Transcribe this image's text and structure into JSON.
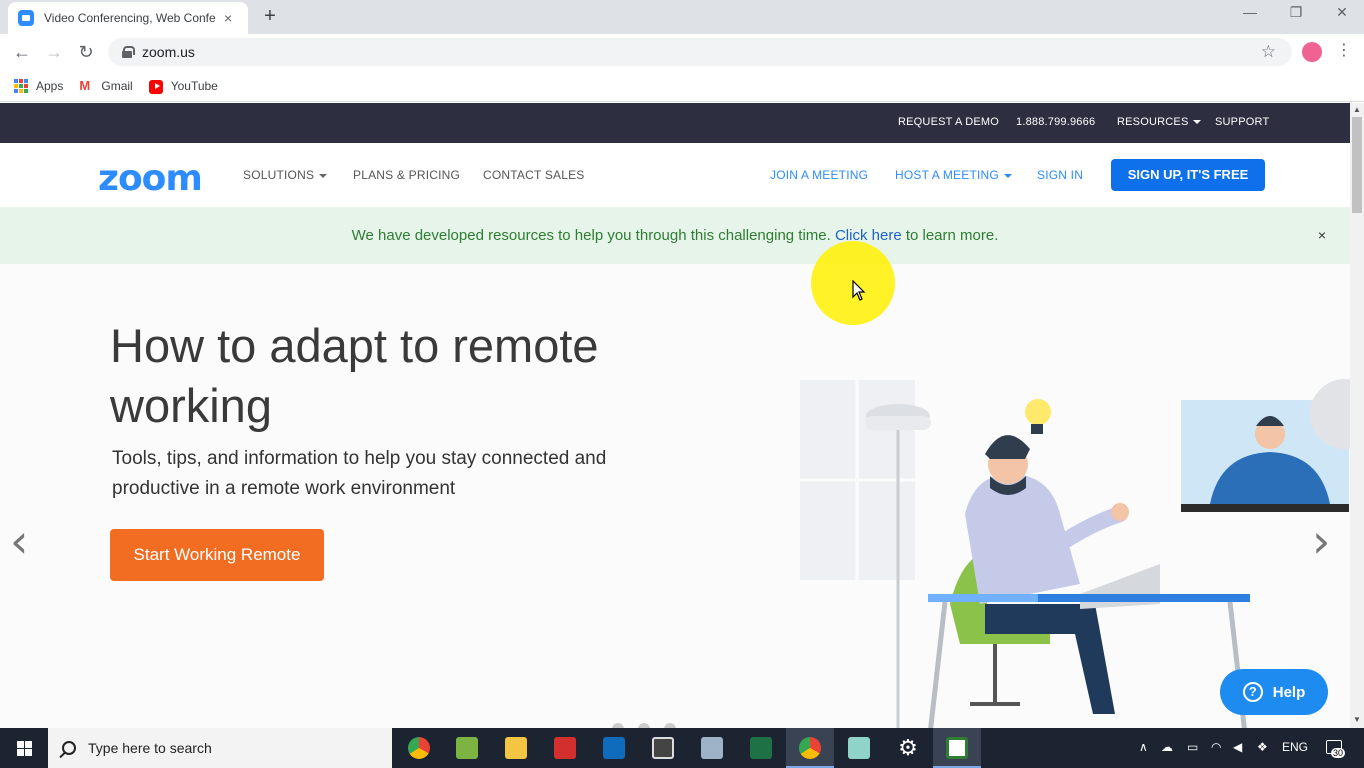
{
  "browser": {
    "tab_title": "Video Conferencing, Web Conferencing, Webinars",
    "tab_close": "×",
    "new_tab": "+",
    "url": "zoom.us",
    "bookmarks": [
      {
        "label": "Apps"
      },
      {
        "label": "Gmail"
      },
      {
        "label": "YouTube"
      }
    ]
  },
  "topbar": {
    "request_demo": "REQUEST A DEMO",
    "phone": "1.888.799.9666",
    "resources": "RESOURCES",
    "support": "SUPPORT"
  },
  "nav": {
    "logo": "zoom",
    "solutions": "SOLUTIONS",
    "plans": "PLANS & PRICING",
    "contact": "CONTACT SALES",
    "join": "JOIN A MEETING",
    "host": "HOST A MEETING",
    "signin": "SIGN IN",
    "signup": "SIGN UP, IT'S FREE"
  },
  "notice": {
    "text_before": "We have developed resources to help you through this challenging time. ",
    "link": "Click here",
    "text_after": " to learn more.",
    "close": "×"
  },
  "hero": {
    "title": "How to adapt to remote working",
    "subtitle": "Tools, tips, and information to help you stay connected and productive in a remote work environment",
    "cta": "Start Working Remote",
    "prev": "‹",
    "next": "›"
  },
  "help": {
    "label": "Help",
    "icon_glyph": "?"
  },
  "taskbar": {
    "search_placeholder": "Type here to search",
    "language": "ENG",
    "notification_count": "30"
  },
  "colors": {
    "zoom_blue": "#2d8cff",
    "signup_blue": "#0e71eb",
    "topbar_dark": "#2d2e40",
    "cta_orange": "#f26d21",
    "notice_green": "#2e7d32",
    "notice_bg": "#e6f4ea"
  }
}
